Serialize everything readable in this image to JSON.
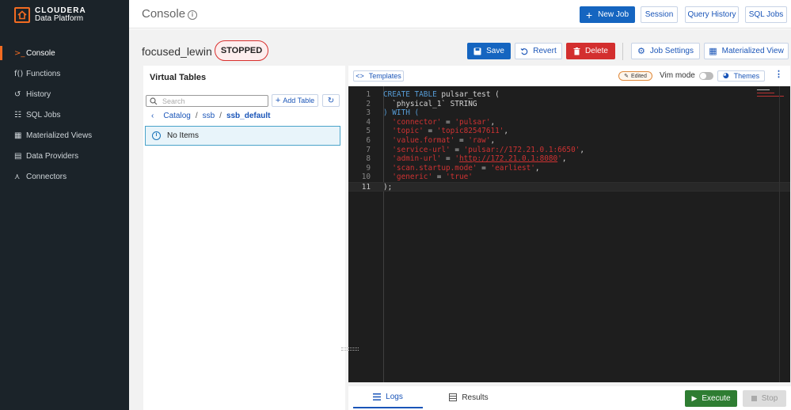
{
  "brand": {
    "line1": "CLOUDERA",
    "line2": "Data Platform",
    "accent": "#f26b21"
  },
  "sidebar": {
    "items": [
      {
        "icon": ">_",
        "label": "Console"
      },
      {
        "icon": "f()",
        "label": "Functions"
      },
      {
        "icon": "↺",
        "label": "History"
      },
      {
        "icon": "☷",
        "label": "SQL Jobs"
      },
      {
        "icon": "▦",
        "label": "Materialized Views"
      },
      {
        "icon": "▤",
        "label": "Data Providers"
      },
      {
        "icon": "⋏",
        "label": "Connectors"
      }
    ]
  },
  "header": {
    "title": "Console",
    "new_job": "New Job",
    "session": "Session",
    "query_history": "Query History",
    "sql_jobs": "SQL Jobs"
  },
  "job": {
    "name": "focused_lewin",
    "status": "STOPPED",
    "save": "Save",
    "revert": "Revert",
    "delete": "Delete",
    "job_settings": "Job Settings",
    "materialized_view": "Materialized View"
  },
  "virtual_tables": {
    "title": "Virtual Tables",
    "search_placeholder": "Search",
    "add_table": "Add Table",
    "breadcrumb": [
      "Catalog",
      "ssb",
      "ssb_default"
    ],
    "empty": "No Items"
  },
  "editor": {
    "templates": "Templates",
    "edited": "Edited",
    "vim_mode": "Vim mode",
    "themes": "Themes",
    "lines": [
      [
        [
          "kw",
          "CREATE TABLE "
        ],
        [
          "id",
          "pulsar_test ("
        ]
      ],
      [
        [
          "id",
          "  `physical_1` STRING"
        ]
      ],
      [
        [
          "kw",
          ") WITH ("
        ]
      ],
      [
        [
          "str",
          "  'connector'"
        ],
        [
          "id",
          " = "
        ],
        [
          "str",
          "'pulsar'"
        ],
        [
          "id",
          ","
        ]
      ],
      [
        [
          "str",
          "  'topic'"
        ],
        [
          "id",
          " = "
        ],
        [
          "str",
          "'topic82547611'"
        ],
        [
          "id",
          ","
        ]
      ],
      [
        [
          "str",
          "  'value.format'"
        ],
        [
          "id",
          " = "
        ],
        [
          "str",
          "'raw'"
        ],
        [
          "id",
          ","
        ]
      ],
      [
        [
          "str",
          "  'service-url'"
        ],
        [
          "id",
          " = "
        ],
        [
          "str",
          "'pulsar://172.21.0.1:6650'"
        ],
        [
          "id",
          ","
        ]
      ],
      [
        [
          "str",
          "  'admin-url'"
        ],
        [
          "id",
          " = "
        ],
        [
          "str",
          "'"
        ],
        [
          "str link",
          "http://172.21.0.1:8080"
        ],
        [
          "str",
          "'"
        ],
        [
          "id",
          ","
        ]
      ],
      [
        [
          "str",
          "  'scan.startup.mode'"
        ],
        [
          "id",
          " = "
        ],
        [
          "str",
          "'earliest'"
        ],
        [
          "id",
          ","
        ]
      ],
      [
        [
          "str",
          "  'generic'"
        ],
        [
          "id",
          " = "
        ],
        [
          "str",
          "'true'"
        ]
      ],
      [
        [
          "id",
          ");"
        ]
      ]
    ]
  },
  "bottom": {
    "logs": "Logs",
    "results": "Results",
    "execute": "Execute",
    "stop": "Stop"
  }
}
